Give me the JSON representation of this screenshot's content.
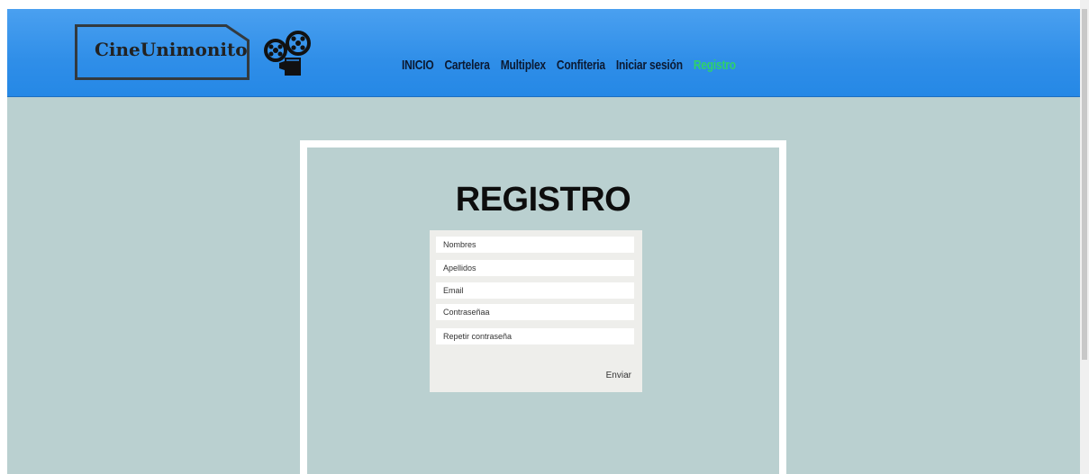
{
  "header": {
    "logo_text": "CineUnimonito",
    "logo_icon": "film-projector-icon",
    "nav": [
      {
        "label": "INICIO",
        "active": false
      },
      {
        "label": "Cartelera",
        "active": false
      },
      {
        "label": "Multiplex",
        "active": false
      },
      {
        "label": "Confiteria",
        "active": false
      },
      {
        "label": "Iniciar sesión",
        "active": false
      },
      {
        "label": "Registro",
        "active": true
      }
    ]
  },
  "main": {
    "title": "REGISTRO",
    "form": {
      "fields": [
        {
          "placeholder": "Nombres",
          "value": ""
        },
        {
          "placeholder": "Apellidos",
          "value": ""
        },
        {
          "placeholder": "Email",
          "value": ""
        },
        {
          "placeholder": "Contraseñaa",
          "value": ""
        },
        {
          "placeholder": "Repetir contraseña",
          "value": ""
        }
      ],
      "submit_label": "Enviar"
    }
  },
  "colors": {
    "header_blue": "#2f8ee8",
    "background": "#bad0d0",
    "nav_active": "#2ed16b",
    "nav_text": "#0b1a33",
    "form_bg": "#eeeeeb"
  }
}
